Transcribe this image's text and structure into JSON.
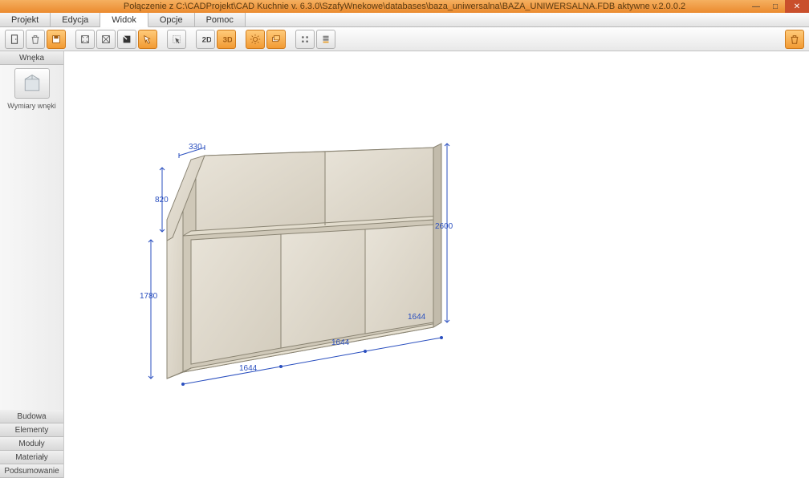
{
  "title": "Połączenie z C:\\CADProjekt\\CAD Kuchnie v. 6.3.0\\SzafyWnekowe\\databases\\baza_uniwersalna\\BAZA_UNIWERSALNA.FDB aktywne  v.2.0.0.2",
  "menu": {
    "items": [
      "Projekt",
      "Edycja",
      "Widok",
      "Opcje",
      "Pomoc"
    ],
    "active_index": 2
  },
  "sidebar": {
    "top_header": "Wnęka",
    "tile_label": "Wymiary wnęki",
    "bottom_headers": [
      "Budowa",
      "Elementy",
      "Moduły",
      "Materiały",
      "Podsumowanie"
    ]
  },
  "dimensions": {
    "top_depth": "330",
    "left_upper": "820",
    "left_lower": "1780",
    "bottom_left": "1644",
    "bottom_mid": "1644",
    "bottom_right": "1644",
    "right_height": "2600"
  }
}
